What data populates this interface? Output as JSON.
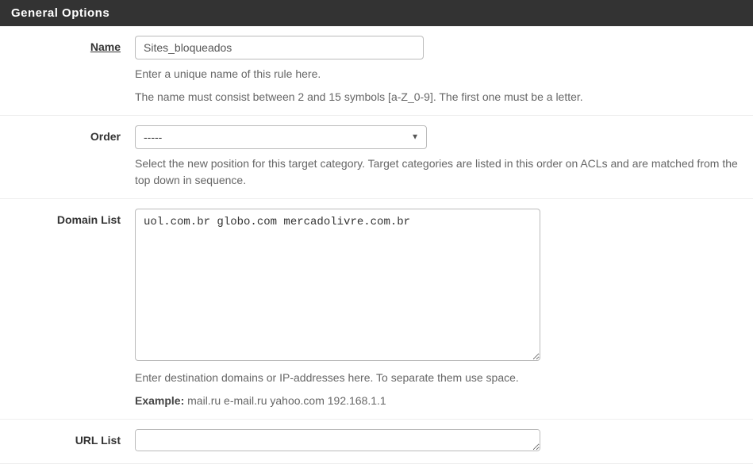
{
  "section_title": "General Options",
  "fields": {
    "name": {
      "label": "Name",
      "value": "Sites_bloqueados",
      "help1": "Enter a unique name of this rule here.",
      "help2": "The name must consist between 2 and 15 symbols [a-Z_0-9]. The first one must be a letter."
    },
    "order": {
      "label": "Order",
      "value": "-----",
      "help": "Select the new position for this target category. Target categories are listed in this order on ACLs and are matched from the top down in sequence."
    },
    "domain_list": {
      "label": "Domain List",
      "value": "uol.com.br globo.com mercadolivre.com.br",
      "help": "Enter destination domains or IP-addresses here. To separate them use space.",
      "example_label": "Example:",
      "example_text": " mail.ru e-mail.ru yahoo.com 192.168.1.1"
    },
    "url_list": {
      "label": "URL List",
      "value": ""
    }
  }
}
